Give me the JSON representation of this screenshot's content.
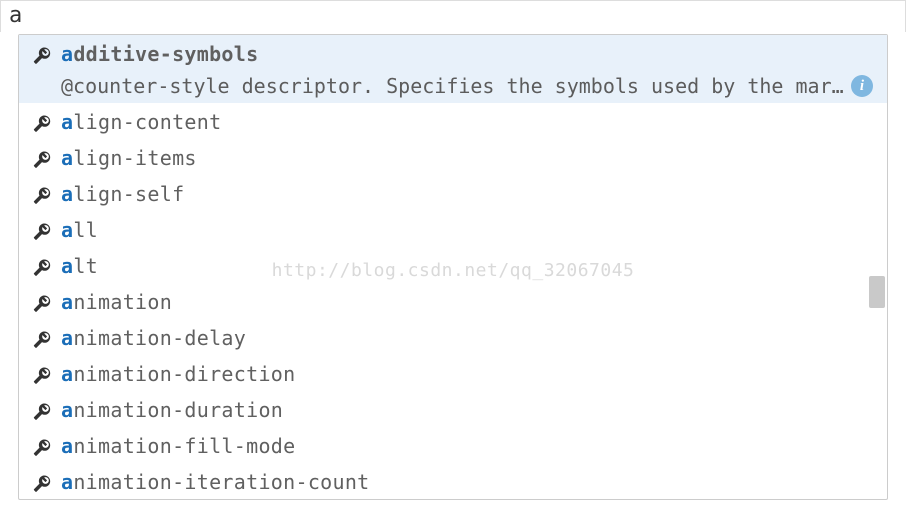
{
  "search": {
    "value": "a"
  },
  "watermark": "http://blog.csdn.net/qq_32067045",
  "match_prefix": "a",
  "suggestions": [
    {
      "label": "additive-symbols",
      "selected": true,
      "description": "@counter-style descriptor. Specifies the symbols used by the mark..."
    },
    {
      "label": "align-content"
    },
    {
      "label": "align-items"
    },
    {
      "label": "align-self"
    },
    {
      "label": "all"
    },
    {
      "label": "alt"
    },
    {
      "label": "animation"
    },
    {
      "label": "animation-delay"
    },
    {
      "label": "animation-direction"
    },
    {
      "label": "animation-duration"
    },
    {
      "label": "animation-fill-mode"
    },
    {
      "label": "animation-iteration-count"
    }
  ]
}
